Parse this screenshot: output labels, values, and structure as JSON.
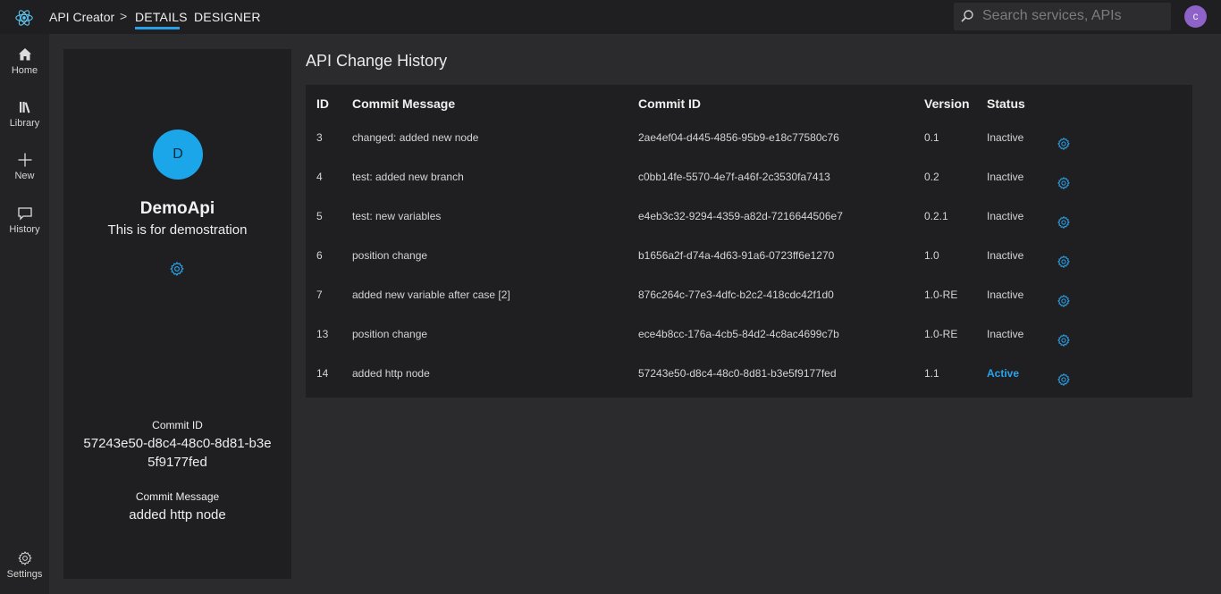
{
  "topbar": {
    "app_name": "API Creator",
    "chevron": ">",
    "tabs": [
      {
        "label": "DETAILS",
        "active": true
      },
      {
        "label": "DESIGNER",
        "active": false
      }
    ],
    "search_placeholder": "Search services, APIs",
    "user_initial": "c"
  },
  "nav": {
    "items": [
      {
        "label": "Home",
        "icon": "home-icon"
      },
      {
        "label": "Library",
        "icon": "library-icon"
      },
      {
        "label": "New",
        "icon": "plus-icon"
      },
      {
        "label": "History",
        "icon": "chat-icon"
      }
    ],
    "settings_label": "Settings"
  },
  "panel": {
    "avatar_initial": "D",
    "name": "DemoApi",
    "description": "This is for demostration",
    "commit_id_label": "Commit ID",
    "commit_id_value": "57243e50-d8c4-48c0-8d81-b3e5f9177fed",
    "commit_message_label": "Commit Message",
    "commit_message_value": "added http node"
  },
  "main": {
    "title": "API Change History",
    "columns": [
      "ID",
      "Commit Message",
      "Commit ID",
      "Version",
      "Status"
    ],
    "rows": [
      {
        "id": "3",
        "message": "changed: added new node",
        "commit_id": "2ae4ef04-d445-4856-95b9-e18c77580c76",
        "version": "0.1",
        "status": "Inactive"
      },
      {
        "id": "4",
        "message": "test: added new branch",
        "commit_id": "c0bb14fe-5570-4e7f-a46f-2c3530fa7413",
        "version": "0.2",
        "status": "Inactive"
      },
      {
        "id": "5",
        "message": "test: new variables",
        "commit_id": "e4eb3c32-9294-4359-a82d-7216644506e7",
        "version": "0.2.1",
        "status": "Inactive"
      },
      {
        "id": "6",
        "message": "position change",
        "commit_id": "b1656a2f-d74a-4d63-91a6-0723ff6e1270",
        "version": "1.0",
        "status": "Inactive"
      },
      {
        "id": "7",
        "message": "added new variable after case [2]",
        "commit_id": "876c264c-77e3-4dfc-b2c2-418cdc42f1d0",
        "version": "1.0-RE",
        "status": "Inactive"
      },
      {
        "id": "13",
        "message": "position change",
        "commit_id": "ece4b8cc-176a-4cb5-84d2-4c8ac4699c7b",
        "version": "1.0-RE",
        "status": "Inactive"
      },
      {
        "id": "14",
        "message": "added http node",
        "commit_id": "57243e50-d8c4-48c0-8d81-b3e5f9177fed",
        "version": "1.1",
        "status": "Active"
      }
    ]
  },
  "colors": {
    "accent": "#2aa0e6",
    "avatar_user": "#8e63c9",
    "avatar_api": "#1ba6ea"
  }
}
